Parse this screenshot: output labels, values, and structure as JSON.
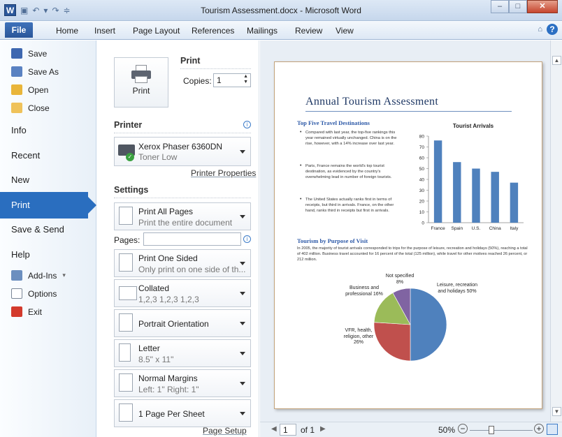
{
  "window": {
    "title": "Tourism Assessment.docx - Microsoft Word",
    "app_icon": "W"
  },
  "ribbon": {
    "tabs": [
      "File",
      "Home",
      "Insert",
      "Page Layout",
      "References",
      "Mailings",
      "Review",
      "View"
    ]
  },
  "backstage": {
    "nav_small": [
      "Save",
      "Save As",
      "Open",
      "Close"
    ],
    "nav_big": [
      "Info",
      "Recent",
      "New",
      "Print",
      "Save & Send",
      "Help"
    ],
    "nav_bottom": [
      "Add-Ins",
      "Options",
      "Exit"
    ]
  },
  "print": {
    "heading": "Print",
    "button_label": "Print",
    "copies_label": "Copies:",
    "copies_value": "1",
    "printer_heading": "Printer",
    "printer_name": "Xerox Phaser 6360DN",
    "printer_status": "Toner Low",
    "printer_properties": "Printer Properties",
    "settings_heading": "Settings",
    "pages_label": "Pages:",
    "page_setup": "Page Setup",
    "settings": [
      {
        "title": "Print All Pages",
        "sub": "Print the entire document"
      },
      {
        "title": "Print One Sided",
        "sub": "Only print on one side of th..."
      },
      {
        "title": "Collated",
        "sub": "1,2,3   1,2,3   1,2,3"
      },
      {
        "title": "Portrait Orientation",
        "sub": ""
      },
      {
        "title": "Letter",
        "sub": "8.5\" x 11\""
      },
      {
        "title": "Normal Margins",
        "sub": "Left: 1\"   Right: 1\""
      },
      {
        "title": "1 Page Per Sheet",
        "sub": ""
      }
    ]
  },
  "preview": {
    "current_page": "1",
    "of_pages": "of 1",
    "zoom": "50%",
    "doc_title": "Annual Tourism Assessment",
    "section1": "Top Five Travel Destinations",
    "bullets": [
      "Compared with last year, the top-five rankings this year remained virtually unchanged. China is on the rise, however, with a 14% increase over last year.",
      "Paris, France remains the world's top tourist destination, as evidenced by the country's overwhelming lead in number of foreign tourists.",
      "The United States actually ranks first in terms of receipts, but third in arrivals. France, on the other hand, ranks third in receipts but first in arrivals."
    ],
    "section2": "Tourism by Purpose of Visit",
    "paragraph": "In 2005, the majority of tourist arrivals corresponded to trips for the purpose of leisure, recreation and holidays (50%), reaching a total of 402 million. Business travel accounted for 16 percent of the total (125 million), while travel for other motives reached 26 percent, or 212 million."
  },
  "chart_data": [
    {
      "type": "bar",
      "title": "Tourist Arrivals",
      "categories": [
        "France",
        "Spain",
        "U.S.",
        "China",
        "Italy"
      ],
      "values": [
        76,
        56,
        50,
        47,
        37
      ],
      "ylim": [
        0,
        80
      ],
      "yticks": [
        "0",
        "10",
        "20",
        "30",
        "40",
        "50",
        "60",
        "70",
        "80"
      ],
      "color": "#4f81bd"
    },
    {
      "type": "pie",
      "labels": [
        "Leisure, recreation and holidays 50%",
        "VFR, health, religion, other 26%",
        "Business and professional 16%",
        "Not specified 8%"
      ],
      "values": [
        50,
        26,
        16,
        8
      ],
      "colors": [
        "#4f81bd",
        "#c0504d",
        "#9bbb59",
        "#8064a2"
      ]
    }
  ],
  "colors": {
    "accent": "#2a6ebf",
    "file_tab": "#2a5699"
  }
}
